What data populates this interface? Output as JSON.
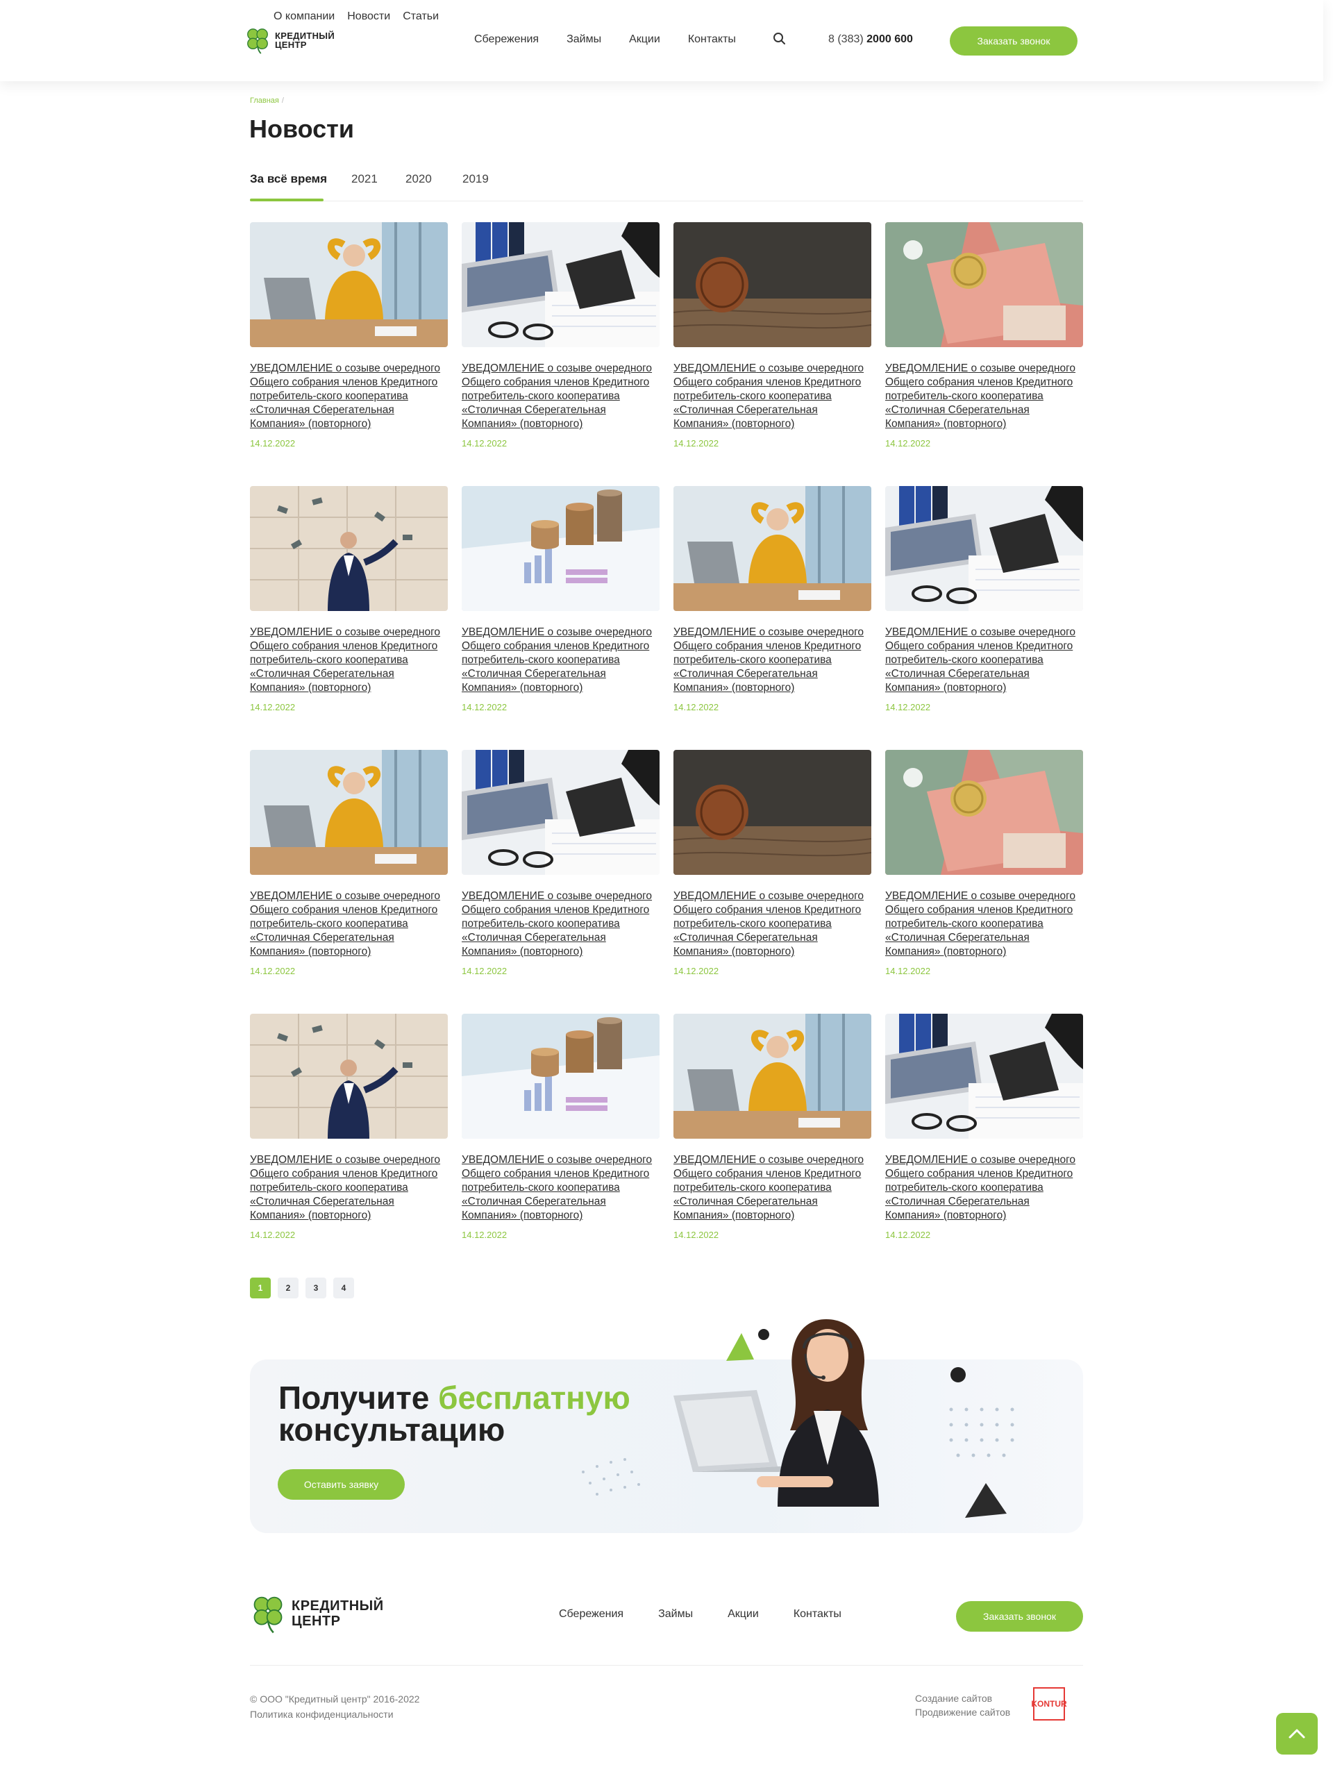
{
  "header": {
    "top_links": [
      "О компании",
      "Новости",
      "Статьи"
    ],
    "logo_line1": "КРЕДИТНЫЙ",
    "logo_line2": "ЦЕНТР",
    "nav": [
      "Сбережения",
      "Займы",
      "Акции",
      "Контакты"
    ],
    "phone_prefix": "8 (383)",
    "phone_number": "2000 600",
    "call_button": "Заказать звонок"
  },
  "breadcrumb": {
    "home": "Главная",
    "separator": "/"
  },
  "page_title": "Новости",
  "tabs": [
    "За всё время",
    "2021",
    "2020",
    "2019"
  ],
  "active_tab": "За всё время",
  "news": [
    {
      "image": "woman-office-yellow",
      "title_caps": "УВЕДОМЛЕНИЕ",
      "title": " о созыве очередного Общего собрания членов Кредитного потребитель-ского кооператива «Столичная Сберегательная Компания» (повторного)",
      "date": "14.12.2022"
    },
    {
      "image": "calculator-glasses",
      "title_caps": "УВЕДОМЛЕНИЕ",
      "title": " о созыве очередного Общего собрания членов Кредитного потребитель-ского кооператива «Столичная Сберегательная Компания» (повторного)",
      "date": "14.12.2022"
    },
    {
      "image": "coin-wood",
      "title_caps": "УВЕДОМЛЕНИЕ",
      "title": " о созыве очередного Общего собрания членов Кредитного потребитель-ского кооператива «Столичная Сберегательная Компания» (повторного)",
      "date": "14.12.2022"
    },
    {
      "image": "banknotes",
      "title_caps": "УВЕДОМЛЕНИЕ",
      "title": " о созыве очередного Общего собрания членов Кредитного потребитель-ского кооператива «Столичная Сберегательная Компания» (повторного)",
      "date": "14.12.2022"
    },
    {
      "image": "man-money-rain",
      "title_caps": "УВЕДОМЛЕНИЕ",
      "title": " о созыве очередного Общего собрания членов Кредитного потребитель-ского кооператива «Столичная Сберегательная Компания» (повторного)",
      "date": "14.12.2022"
    },
    {
      "image": "coins-charts",
      "title_caps": "УВЕДОМЛЕНИЕ",
      "title": " о созыве очередного Общего собрания членов Кредитного потребитель-ского кооператива «Столичная Сберегательная Компания» (повторного)",
      "date": "14.12.2022"
    },
    {
      "image": "woman-office-yellow",
      "title_caps": "УВЕДОМЛЕНИЕ",
      "title": " о созыве очередного Общего собрания членов Кредитного потребитель-ского кооператива «Столичная Сберегательная Компания» (повторного)",
      "date": "14.12.2022"
    },
    {
      "image": "calculator-glasses",
      "title_caps": "УВЕДОМЛЕНИЕ",
      "title": " о созыве очередного Общего собрания членов Кредитного потребитель-ского кооператива «Столичная Сберегательная Компания» (повторного)",
      "date": "14.12.2022"
    },
    {
      "image": "woman-office-yellow",
      "title_caps": "УВЕДОМЛЕНИЕ",
      "title": " о созыве очередного Общего собрания членов Кредитного потребитель-ского кооператива «Столичная Сберегательная Компания» (повторного)",
      "date": "14.12.2022"
    },
    {
      "image": "calculator-glasses",
      "title_caps": "УВЕДОМЛЕНИЕ",
      "title": " о созыве очередного Общего собрания членов Кредитного потребитель-ского кооператива «Столичная Сберегательная Компания» (повторного)",
      "date": "14.12.2022"
    },
    {
      "image": "coin-wood",
      "title_caps": "УВЕДОМЛЕНИЕ",
      "title": " о созыве очередного Общего собрания членов Кредитного потребитель-ского кооператива «Столичная Сберегательная Компания» (повторного)",
      "date": "14.12.2022"
    },
    {
      "image": "banknotes",
      "title_caps": "УВЕДОМЛЕНИЕ",
      "title": " о созыве очередного Общего собрания членов Кредитного потребитель-ского кооператива «Столичная Сберегательная Компания» (повторного)",
      "date": "14.12.2022"
    },
    {
      "image": "man-money-rain",
      "title_caps": "УВЕДОМЛЕНИЕ",
      "title": " о созыве очередного Общего собрания членов Кредитного потребитель-ского кооператива «Столичная Сберегательная Компания» (повторного)",
      "date": "14.12.2022"
    },
    {
      "image": "coins-charts",
      "title_caps": "УВЕДОМЛЕНИЕ",
      "title": " о созыве очередного Общего собрания членов Кредитного потребитель-ского кооператива «Столичная Сберегательная Компания» (повторного)",
      "date": "14.12.2022"
    },
    {
      "image": "woman-office-yellow",
      "title_caps": "УВЕДОМЛЕНИЕ",
      "title": " о созыве очередного Общего собрания членов Кредитного потребитель-ского кооператива «Столичная Сберегательная Компания» (повторного)",
      "date": "14.12.2022"
    },
    {
      "image": "calculator-glasses",
      "title_caps": "УВЕДОМЛЕНИЕ",
      "title": " о созыве очередного Общего собрания членов Кредитного потребитель-ского кооператива «Столичная Сберегательная Компания» (повторного)",
      "date": "14.12.2022"
    }
  ],
  "pagination": {
    "pages": [
      "1",
      "2",
      "3",
      "4"
    ],
    "current": "1"
  },
  "promo": {
    "title_part1": "Получите ",
    "title_highlight": "бесплатную",
    "title_part2": "консультацию",
    "button": "Оставить заявку"
  },
  "footer": {
    "logo_line1": "КРЕДИТНЫЙ",
    "logo_line2": "ЦЕНТР",
    "nav": [
      "Сбережения",
      "Займы",
      "Акции",
      "Контакты"
    ],
    "call_button": "Заказать звонок",
    "copyright": "© ООО \"Кредитный центр\" 2016-2022",
    "privacy": "Политика конфиденциальности",
    "dev_line1": "Создание сайтов",
    "dev_line2": "Продвижение сайтов",
    "dev_logo": "KONTUR"
  },
  "colors": {
    "accent": "#8cc63f",
    "text": "#2a2a2a",
    "kontur": "#e53935"
  }
}
